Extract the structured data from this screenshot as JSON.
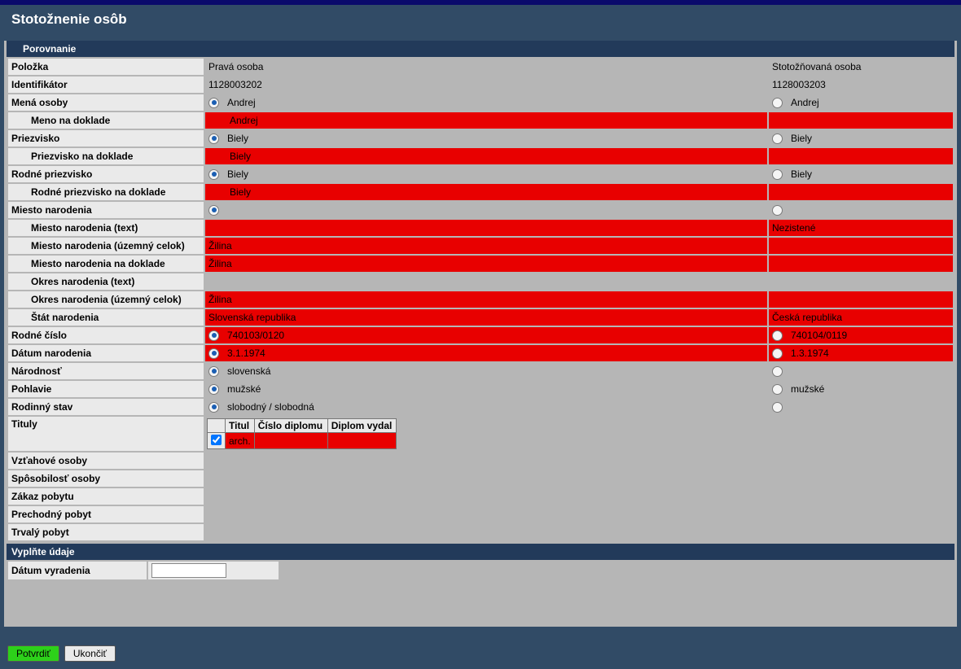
{
  "page_title": "Stotožnenie osôb",
  "sections": {
    "compare": "Porovnanie",
    "fill": "Vyplňte údaje"
  },
  "headers": {
    "field": "Položka",
    "left": "Pravá osoba",
    "right": "Stotožňovaná osoba"
  },
  "rows": {
    "identifier_label": "Identifikátor",
    "identifier_left": "1128003202",
    "identifier_right": "1128003203",
    "names_label": "Mená osoby",
    "names_left": "Andrej",
    "names_right": "Andrej",
    "name_doc_label": "Meno na doklade",
    "name_doc_left": "Andrej",
    "name_doc_right": "",
    "surname_label": "Priezvisko",
    "surname_left": "Biely",
    "surname_right": "Biely",
    "surname_doc_label": "Priezvisko na doklade",
    "surname_doc_left": "Biely",
    "surname_doc_right": "",
    "birth_surname_label": "Rodné priezvisko",
    "birth_surname_left": "Biely",
    "birth_surname_right": "Biely",
    "birth_surname_doc_label": "Rodné priezvisko na doklade",
    "birth_surname_doc_left": "Biely",
    "birth_surname_doc_right": "",
    "birthplace_label": "Miesto narodenia",
    "birthplace_text_label": "Miesto narodenia (text)",
    "birthplace_text_left": "",
    "birthplace_text_right": "Nezistené",
    "birthplace_region_label": "Miesto narodenia (územný celok)",
    "birthplace_region_left": "Žilina",
    "birthplace_region_right": "",
    "birthplace_doc_label": "Miesto narodenia na doklade",
    "birthplace_doc_left": "Žilina",
    "birthplace_doc_right": "",
    "district_text_label": "Okres narodenia (text)",
    "district_region_label": "Okres narodenia (územný celok)",
    "district_region_left": "Žilina",
    "district_region_right": "",
    "state_label": "Štát narodenia",
    "state_left": "Slovenská republika",
    "state_right": "Česká republika",
    "pid_label": "Rodné číslo",
    "pid_left": "740103/0120",
    "pid_right": "740104/0119",
    "dob_label": "Dátum narodenia",
    "dob_left": "3.1.1974",
    "dob_right": "1.3.1974",
    "nationality_label": "Národnosť",
    "nationality_left": "slovenská",
    "sex_label": "Pohlavie",
    "sex_left": "mužské",
    "sex_right": "mužské",
    "marital_label": "Rodinný stav",
    "marital_left": "slobodný / slobodná",
    "titles_label": "Tituly",
    "titles_table": {
      "h_title": "Titul",
      "h_diploma_no": "Číslo diplomu",
      "h_diploma_by": "Diplom vydal",
      "row_title": "arch."
    },
    "rel_persons_label": "Vzťahové osoby",
    "capacity_label": "Spôsobilosť osoby",
    "stay_ban_label": "Zákaz pobytu",
    "temp_stay_label": "Prechodný pobyt",
    "perm_stay_label": "Trvalý pobyt",
    "discard_date_label": "Dátum vyradenia"
  },
  "buttons": {
    "confirm": "Potvrdiť",
    "close": "Ukončiť"
  }
}
